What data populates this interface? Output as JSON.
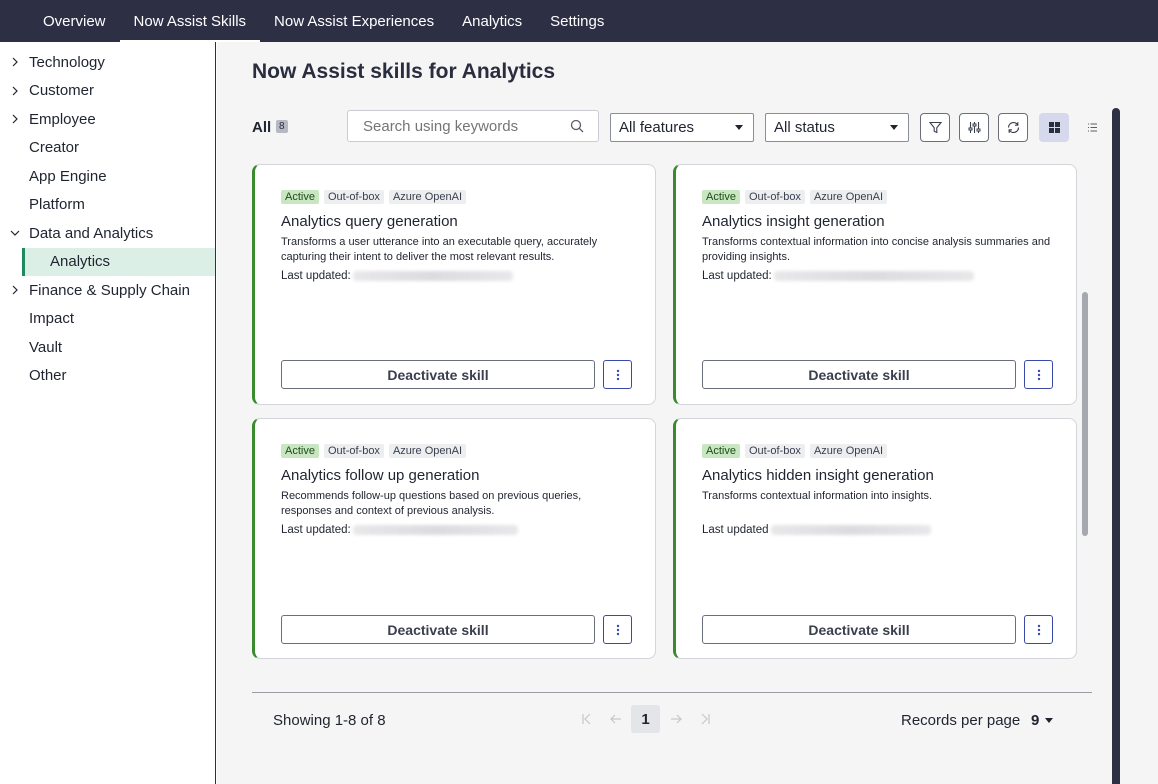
{
  "topnav": {
    "tabs": [
      {
        "label": "Overview",
        "active": false
      },
      {
        "label": "Now Assist Skills",
        "active": true
      },
      {
        "label": "Now Assist Experiences",
        "active": false
      },
      {
        "label": "Analytics",
        "active": false
      },
      {
        "label": "Settings",
        "active": false
      }
    ]
  },
  "sidebar": {
    "items": [
      {
        "label": "Technology",
        "expandable": true,
        "expanded": false
      },
      {
        "label": "Customer",
        "expandable": true,
        "expanded": false
      },
      {
        "label": "Employee",
        "expandable": true,
        "expanded": false
      },
      {
        "label": "Creator",
        "expandable": false
      },
      {
        "label": "App Engine",
        "expandable": false
      },
      {
        "label": "Platform",
        "expandable": false
      },
      {
        "label": "Data and Analytics",
        "expandable": true,
        "expanded": true
      },
      {
        "label": "Analytics",
        "sub": true,
        "selected": true
      },
      {
        "label": "Finance & Supply Chain",
        "expandable": true,
        "expanded": false
      },
      {
        "label": "Impact",
        "expandable": false
      },
      {
        "label": "Vault",
        "expandable": false
      },
      {
        "label": "Other",
        "expandable": false
      }
    ]
  },
  "main": {
    "title": "Now Assist skills for Analytics",
    "all_label": "All",
    "all_count": "8",
    "search_placeholder": "Search using keywords",
    "features_select": "All features",
    "status_select": "All status",
    "cards": [
      {
        "tags": [
          "Active",
          "Out-of-box",
          "Azure OpenAI"
        ],
        "title": "Analytics query generation",
        "description": "Transforms a user utterance into an executable query, accurately capturing their intent to deliver the most relevant results.",
        "last_updated": "Last updated:",
        "button": "Deactivate skill"
      },
      {
        "tags": [
          "Active",
          "Out-of-box",
          "Azure OpenAI"
        ],
        "title": "Analytics insight generation",
        "description": "Transforms contextual information into concise analysis summaries and providing insights.",
        "last_updated": "Last updated:",
        "button": "Deactivate skill"
      },
      {
        "tags": [
          "Active",
          "Out-of-box",
          "Azure OpenAI"
        ],
        "title": "Analytics follow up generation",
        "description": "Recommends follow-up questions based on previous queries, responses and context of previous analysis.",
        "last_updated": "Last updated:",
        "button": "Deactivate skill"
      },
      {
        "tags": [
          "Active",
          "Out-of-box",
          "Azure OpenAI"
        ],
        "title": "Analytics hidden insight generation",
        "description": "Transforms contextual information into insights.",
        "last_updated": "Last updated",
        "button": "Deactivate skill"
      }
    ],
    "footer": {
      "showing": "Showing 1-8 of 8",
      "current_page": "1",
      "records_label": "Records per page",
      "records_value": "9"
    }
  },
  "colors": {
    "nav_bg": "#2d2f45",
    "card_accent": "#3a8a2e",
    "active_tag": "#c8e6c2",
    "selected_sidebar": "#dcefe6"
  }
}
